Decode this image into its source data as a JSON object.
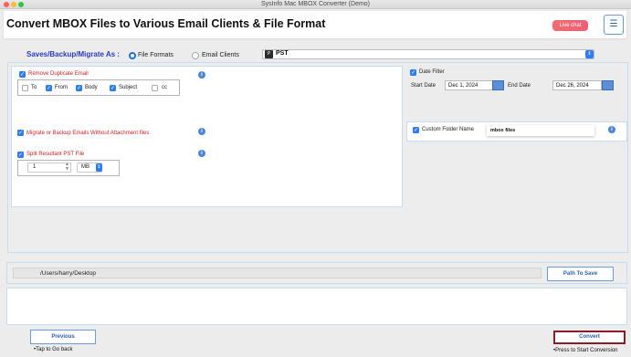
{
  "window": {
    "title": "SysInfo Mac MBOX Converter (Demo)"
  },
  "header": {
    "heading": "Convert MBOX Files to Various Email Clients & File Format",
    "live_chat": "Live chat",
    "menu_icon": "hamburger-icon"
  },
  "save_as": {
    "label": "Saves/Backup/Migrate As :",
    "options": [
      {
        "label": "File Formats",
        "selected": true
      },
      {
        "label": "Email Clients",
        "selected": false
      }
    ],
    "format_value": "PST",
    "format_icon_text": "P"
  },
  "options": {
    "remove_duplicate": {
      "label": "Remove Duplicate Email",
      "checked": true
    },
    "fields": [
      {
        "label": "To",
        "checked": false
      },
      {
        "label": "From",
        "checked": true
      },
      {
        "label": "Body",
        "checked": true
      },
      {
        "label": "Subject",
        "checked": true
      },
      {
        "label": "cc",
        "checked": false
      }
    ],
    "no_attachment": {
      "label": "Migrate or Backup Emails Without Attachment files",
      "checked": true
    },
    "split_pst": {
      "label": "Split Resultant PST File",
      "checked": true,
      "size_value": "1",
      "unit": "MB"
    },
    "date_filter": {
      "label": "Date Filter",
      "checked": true,
      "start_label": "Start Date",
      "start_value": "Dec 1, 2024",
      "end_label": "End Date",
      "end_value": "Dec 26, 2024"
    },
    "custom_folder": {
      "label": "Custom Folder Name",
      "checked": true,
      "value": "mbox files"
    }
  },
  "destination": {
    "path": "/Users/harry/Desktop",
    "button": "Path To Save"
  },
  "footer": {
    "previous": "Previous",
    "previous_hint": "•Tap to Go back",
    "convert": "Convert",
    "convert_hint": "•Press to Start Conversion"
  },
  "colors": {
    "accent_blue": "#2f7df0",
    "heading_blue": "#2a3cb5",
    "warning_red": "#d42020",
    "convert_border": "#8b1c2a"
  }
}
